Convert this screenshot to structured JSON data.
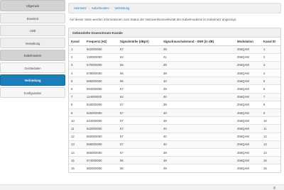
{
  "sidebar": {
    "items": [
      {
        "label": "Allgemein",
        "kind": "group"
      },
      {
        "label": "Erweitert",
        "kind": "group-light"
      },
      {
        "label": "USB",
        "kind": "group-light"
      },
      {
        "label": "Verwaltung",
        "kind": "group-light"
      },
      {
        "label": "Kabelmodem",
        "kind": "group"
      },
      {
        "label": "Gerätedaten",
        "kind": "sub"
      },
      {
        "label": "Verbindung",
        "kind": "active"
      },
      {
        "label": "Konfiguration",
        "kind": "sub"
      }
    ]
  },
  "breadcrumb": [
    "Heimnetz",
    "Kabelmodem",
    "Verbindung"
  ],
  "intro": "Auf dieser Seite werden Informationen zum Status der Netzwerkkonnektivität des Kabelmodems im Kabelnetz angezeigt.",
  "panel": {
    "title": "Gebündelte Downstream-Kanäle",
    "columns": [
      "Kanal",
      "Frequenz (Hz)",
      "Signalstärke (dBµV)",
      "Signalrauschabstand - SNR (in dB)",
      "Modulation",
      "Kanal ID"
    ],
    "rows": [
      [
        "1",
        "602000000",
        "57",
        "39",
        "256QAM",
        "1"
      ],
      [
        "2",
        "130000000",
        "62",
        "41",
        "256QAM",
        "2"
      ],
      [
        "3",
        "570000000",
        "56",
        "39",
        "256QAM",
        "3"
      ],
      [
        "4",
        "578000000",
        "56",
        "39",
        "256QAM",
        "4"
      ],
      [
        "5",
        "586000000",
        "56",
        "40",
        "256QAM",
        "5"
      ],
      [
        "6",
        "594000000",
        "57",
        "39",
        "256QAM",
        "6"
      ],
      [
        "7",
        "114000000",
        "62",
        "40",
        "256QAM",
        "7"
      ],
      [
        "8",
        "618000000",
        "57",
        "39",
        "256QAM",
        "8"
      ],
      [
        "9",
        "626000000",
        "57",
        "40",
        "256QAM",
        "9"
      ],
      [
        "10",
        "634000000",
        "57",
        "39",
        "256QAM",
        "10"
      ],
      [
        "11",
        "642000000",
        "57",
        "40",
        "256QAM",
        "11"
      ],
      [
        "12",
        "650000000",
        "57",
        "40",
        "256QAM",
        "12"
      ],
      [
        "13",
        "658000000",
        "57",
        "40",
        "256QAM",
        "13"
      ],
      [
        "14",
        "666000000",
        "57",
        "39",
        "256QAM",
        "14"
      ],
      [
        "15",
        "674000000",
        "56",
        "39",
        "256QAM",
        "15"
      ],
      [
        "16",
        "682000000",
        "56",
        "39",
        "256QAM",
        "16"
      ]
    ]
  }
}
